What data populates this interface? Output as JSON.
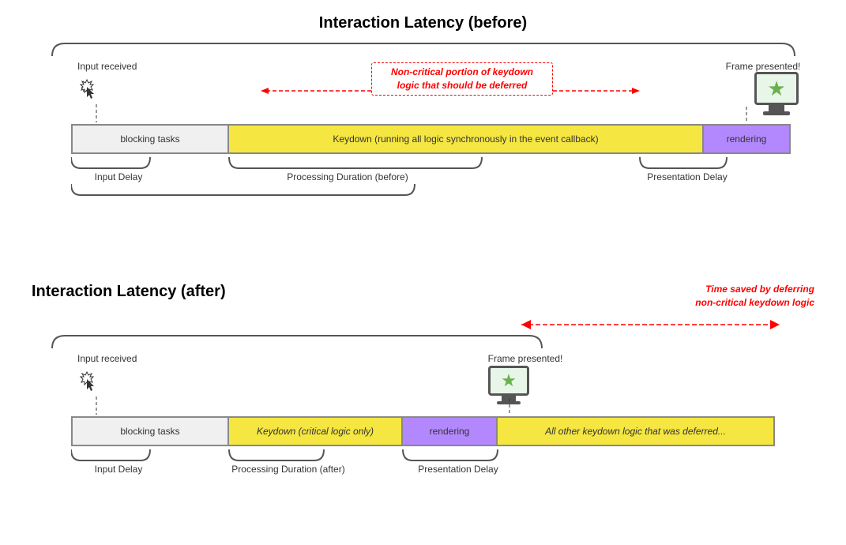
{
  "top": {
    "title": "Interaction Latency (before)",
    "input_received": "Input received",
    "frame_presented": "Frame presented!",
    "red_annotation_line1": "Non-critical portion of keydown",
    "red_annotation_line2": "logic that should be deferred",
    "blocking_tasks": "blocking tasks",
    "keydown_label": "Keydown (running all logic synchronously in the event callback)",
    "rendering": "rendering",
    "input_delay": "Input Delay",
    "processing_duration": "Processing Duration (before)",
    "presentation_delay": "Presentation Delay"
  },
  "bottom": {
    "title": "Interaction Latency (after)",
    "time_saved_line1": "Time saved by deferring",
    "time_saved_line2": "non-critical keydown logic",
    "input_received": "Input received",
    "frame_presented": "Frame presented!",
    "blocking_tasks": "blocking tasks",
    "keydown_label": "Keydown (critical logic only)",
    "rendering": "rendering",
    "deferred_label": "All other keydown logic that was deferred...",
    "input_delay": "Input Delay",
    "processing_duration": "Processing Duration (after)",
    "presentation_delay": "Presentation Delay"
  }
}
